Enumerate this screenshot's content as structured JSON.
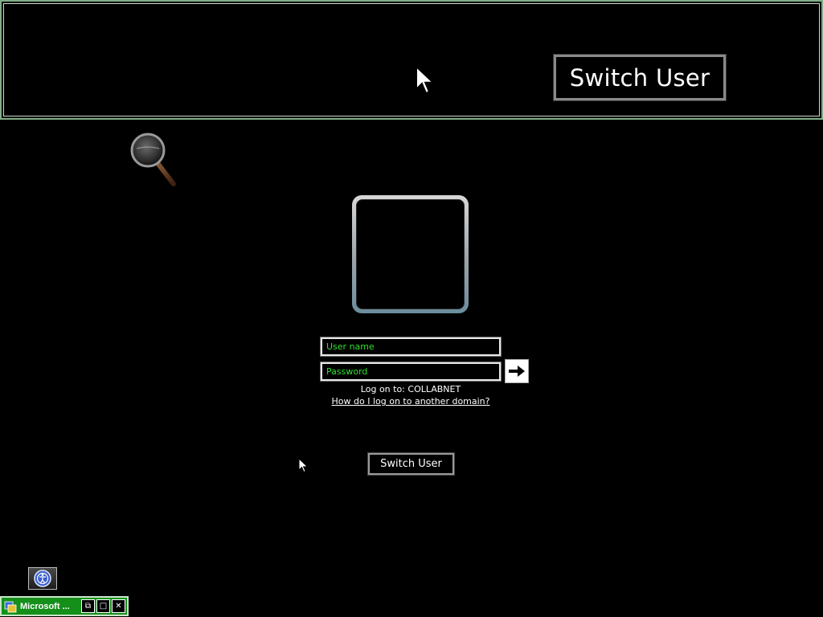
{
  "magnifier": {
    "switch_user_label": "Switch User"
  },
  "login": {
    "username_placeholder": "User name",
    "password_placeholder": "Password",
    "submit_icon": "arrow-right-icon",
    "logon_to": "Log on to: COLLABNET",
    "domain_help_link": "How do I log on to another domain?",
    "switch_user_label": "Switch User"
  },
  "ease_of_access": {
    "icon": "ease-of-access-icon"
  },
  "minimized_window": {
    "title": "Microsoft ...",
    "restore_glyph": "⧉",
    "maximize_glyph": "□",
    "close_glyph": "✕"
  },
  "colors": {
    "field_text": "#33ff33",
    "magnifier_border": "#7fae86",
    "minimized_bar": "#148f1a"
  }
}
